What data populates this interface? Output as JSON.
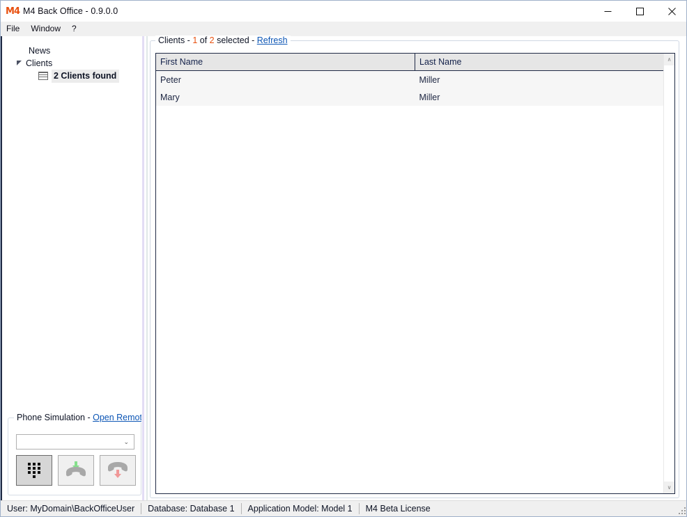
{
  "window": {
    "logo_text": "M4",
    "logo_icon": "m4-logo-icon",
    "title": "M4 Back Office - 0.9.0.0",
    "minimize_label": "—",
    "maximize_label": "☐",
    "close_label": "✕"
  },
  "menubar": {
    "items": [
      {
        "label": "File"
      },
      {
        "label": "Window"
      },
      {
        "label": "?"
      }
    ]
  },
  "tree": {
    "nodes": [
      {
        "label": "News",
        "bold": false,
        "selected": false,
        "icon": "",
        "expander": ""
      },
      {
        "label": "Clients",
        "bold": false,
        "selected": false,
        "icon": "",
        "expander": "expanded"
      },
      {
        "label": "2 Clients found",
        "bold": true,
        "selected": true,
        "icon": "grid-icon",
        "expander": ""
      }
    ]
  },
  "phone_panel": {
    "caption_prefix": "Phone Simulation - ",
    "open_remote_link": "Open Remote",
    "combo_value": "",
    "combo_placeholder": "",
    "combo_chevron": "⌄",
    "buttons": [
      {
        "name": "dialpad-button",
        "state": "pressed",
        "icon": "dialpad-icon"
      },
      {
        "name": "answer-call-button",
        "state": "normal",
        "icon": "phone-up-arrow-icon"
      },
      {
        "name": "hangup-call-button",
        "state": "normal",
        "icon": "phone-down-arrow-icon"
      }
    ]
  },
  "clients_panel": {
    "caption": {
      "prefix": "Clients - ",
      "selected_count": "1",
      "mid": " of ",
      "total_count": "2",
      "suffix": " selected - ",
      "refresh_link": "Refresh"
    },
    "columns": [
      {
        "key": "first_name",
        "label": "First Name"
      },
      {
        "key": "last_name",
        "label": "Last Name"
      }
    ],
    "rows": [
      {
        "first_name": "Peter",
        "last_name": "Miller"
      },
      {
        "first_name": "Mary",
        "last_name": "Miller"
      }
    ],
    "scrollbar": {
      "up_arrow": "∧",
      "down_arrow": "∨"
    }
  },
  "statusbar": {
    "cells": [
      {
        "label": "User: MyDomain\\BackOfficeUser"
      },
      {
        "label": "Database: Database 1"
      },
      {
        "label": "Application Model: Model 1"
      },
      {
        "label": "M4 Beta License"
      }
    ]
  },
  "colors": {
    "accent_orange": "#e8500f",
    "link_blue": "#0b55b5",
    "grid_border": "#1f2a44",
    "header_gray": "#e6e6e6",
    "row_gray": "#f6f6f6"
  }
}
